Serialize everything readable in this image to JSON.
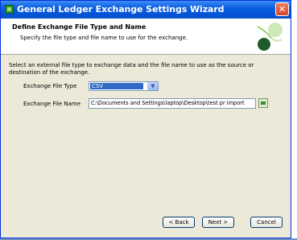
{
  "window": {
    "title": "General Ledger Exchange Settings Wizard",
    "close_glyph": "✕"
  },
  "header": {
    "title": "Define Exchange File Type and Name",
    "subtitle": "Specify the file type and file name to use for the exchange."
  },
  "body": {
    "description": "Select an external file type to exchange data and the file name to use as the source or destination of the exchange."
  },
  "form": {
    "file_type_label": "Exchange File Type",
    "file_type_value": "CSV",
    "file_name_label": "Exchange File Name",
    "file_name_value": "C:\\Documents and Settings\\laptop\\Desktop\\test pr import"
  },
  "buttons": {
    "back": "< Back",
    "next": "Next >",
    "cancel": "Cancel"
  },
  "icons": {
    "app": "ledger-app-icon",
    "close": "close-icon",
    "dropdown": "chevron-down-icon",
    "browse": "folder-browse-icon",
    "wizard": "wizard-art-icon"
  },
  "colors": {
    "titlebar": "#0a5fe0",
    "dialog_face": "#ece9d8",
    "selection": "#316ac5",
    "close_button": "#d3462a"
  }
}
